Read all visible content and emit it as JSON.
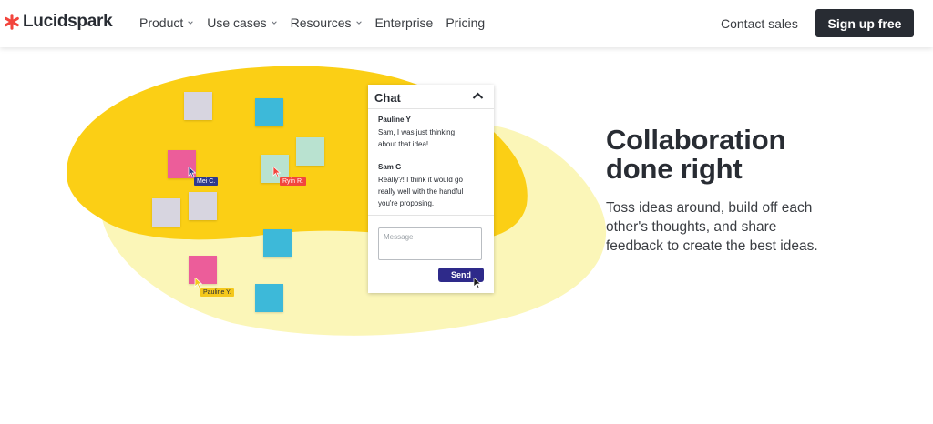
{
  "header": {
    "logo_text": "Lucidspark",
    "nav": [
      {
        "label": "Product",
        "has_menu": true
      },
      {
        "label": "Use cases",
        "has_menu": true
      },
      {
        "label": "Resources",
        "has_menu": true
      },
      {
        "label": "Enterprise",
        "has_menu": false
      },
      {
        "label": "Pricing",
        "has_menu": false
      }
    ],
    "contact_label": "Contact sales",
    "signup_label": "Sign up free"
  },
  "canvas": {
    "tags": [
      {
        "label": "Mei C.",
        "bg": "#2e3a8c",
        "fg": "#ffffff"
      },
      {
        "label": "Ryin R.",
        "bg": "#f2453d",
        "fg": "#ffffff"
      },
      {
        "label": "Pauline Y.",
        "bg": "#f4c81c",
        "fg": "#282c33"
      }
    ]
  },
  "chat": {
    "title": "Chat",
    "messages": [
      {
        "author": "Pauline Y",
        "lines": [
          "Sam, I was just thinking",
          "about that idea!"
        ]
      },
      {
        "author": "Sam G",
        "lines": [
          "Really?! I think it would go",
          "really well with the handful",
          "you're proposing."
        ]
      }
    ],
    "input_placeholder": "Message",
    "send_label": "Send"
  },
  "hero": {
    "title_line1": "Collaboration",
    "title_line2": "done right",
    "body_lines": [
      "Toss ideas around, build off each",
      "other's thoughts, and share",
      "feedback to create the best ideas."
    ]
  },
  "colors": {
    "blob_yellow": "#fbcf15",
    "blob_pale": "#fbf6b8",
    "note_gray": "#d7d5e0",
    "note_cyan": "#3db9d9",
    "note_pink": "#ec5d9a",
    "note_mint": "#b9e2d0",
    "send_button": "#2e2a8a",
    "signup_button": "#282c33",
    "logo_red": "#f2453d"
  }
}
